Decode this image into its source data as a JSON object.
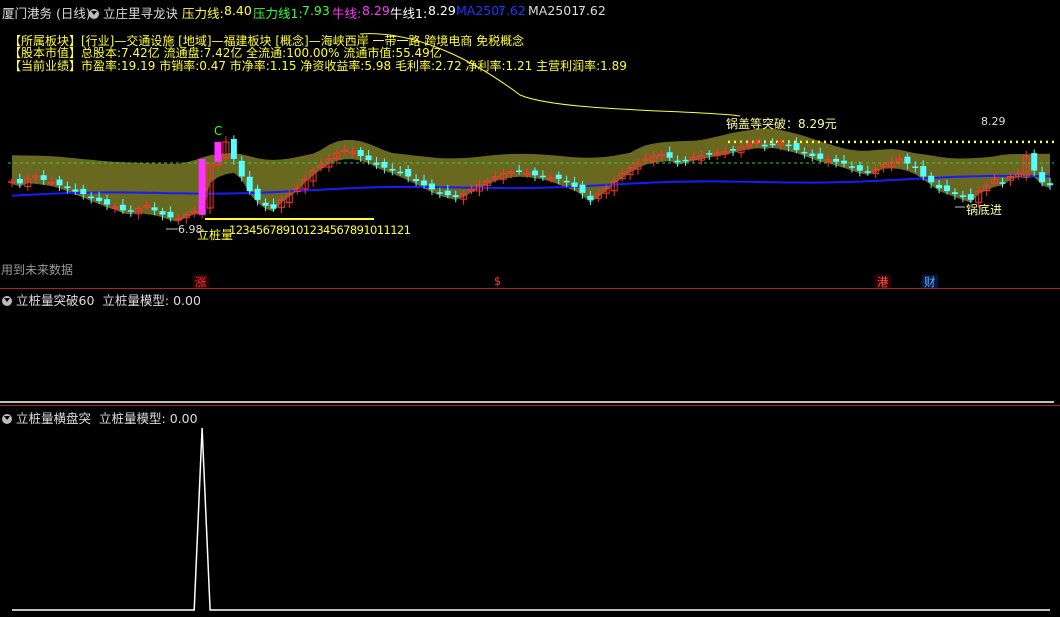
{
  "header": {
    "title": "厦门港务 (日线)",
    "indicator": "立庄里寻龙诀",
    "pressure_label": "压力线:",
    "pressure_value": "8.40",
    "pressure1_label": "压力线1:",
    "pressure1_value": "7.93",
    "bull_label": "牛线:",
    "bull_value": "8.29",
    "bull1_label": "牛线1:",
    "bull1_value": "8.29",
    "ma250_label": "MA250:",
    "ma250_value": "7.62",
    "ma2501_label": "MA2501:",
    "ma2501_value": "7.62"
  },
  "info": {
    "line1": "【所属板块】[行业]—交通设施 [地域]—福建板块 [概念]—海峡西岸 一带一路 跨境电商 免税概念",
    "line2": "【股本市值】总股本:7.42亿 流通盘:7.42亿 全流通:100.00% 流通市值:55.49亿",
    "line3": "【当前业绩】市盈率:19.19 市销率:0.47 市净率:1.15 净资收益率:5.98 毛利率:2.72 净利率:1.21 主营利润率:1.89"
  },
  "annotations": {
    "c_label": "C",
    "pot_break": "锅盖等突破：8.29元",
    "price_829": "8.29",
    "pot_bottom": "锅底进",
    "low_price": "6.98",
    "lizhuang": "立桩量",
    "counter": "123456789101234567891011121",
    "future_data": "用到未来数据"
  },
  "event_tags": [
    {
      "text": "涨",
      "color": "#ff3333",
      "bg": "#330000"
    },
    {
      "text": "$",
      "color": "#ff3333",
      "bg": ""
    },
    {
      "text": "港",
      "color": "#ff5555",
      "bg": "#330000"
    },
    {
      "text": "财",
      "color": "#66aaff",
      "bg": "#001a44"
    }
  ],
  "panel2": {
    "name": "立桩量突破60",
    "model_label": "立桩量模型:",
    "model_value": "0.00"
  },
  "panel3": {
    "name": "立桩量横盘突",
    "model_label": "立桩量模型:",
    "model_value": "0.00"
  },
  "colors": {
    "up": "#ff3333",
    "down": "#54ffff",
    "cloud": "#7a7a26",
    "ma": "#1a1aff",
    "yellow": "#ffff33",
    "pink": "#ff33ff"
  },
  "chart_data": [
    {
      "type": "candlestick",
      "title": "厦门港务 (日线)",
      "pressure_line": 8.4,
      "pressure_line_1": 7.93,
      "bull_line": 8.29,
      "ma250": 7.62,
      "breakout_price": 8.29,
      "low_annotation": 6.98,
      "close": [
        7.62,
        7.58,
        7.66,
        7.71,
        7.64,
        7.6,
        7.55,
        7.5,
        7.44,
        7.4,
        7.33,
        7.28,
        7.22,
        7.18,
        7.12,
        7.1,
        7.15,
        7.2,
        7.12,
        7.05,
        7.0,
        6.98,
        7.05,
        7.1,
        7.12,
        7.9,
        8.05,
        8.29,
        8.0,
        7.7,
        7.45,
        7.3,
        7.2,
        7.15,
        7.3,
        7.4,
        7.5,
        7.65,
        7.8,
        7.9,
        8.0,
        8.1,
        8.15,
        8.12,
        8.05,
        7.98,
        7.9,
        7.85,
        7.8,
        7.78,
        7.7,
        7.62,
        7.55,
        7.48,
        7.42,
        7.38,
        7.35,
        7.4,
        7.48,
        7.56,
        7.62,
        7.7,
        7.75,
        7.78,
        7.8,
        7.76,
        7.72,
        7.7,
        7.68,
        7.66,
        7.6,
        7.52,
        7.42,
        7.3,
        7.4,
        7.5,
        7.62,
        7.75,
        7.85,
        7.93,
        8.0,
        8.05,
        8.08,
        8.02,
        7.95,
        7.98,
        8.02,
        8.05,
        8.08,
        8.1,
        8.12,
        8.15,
        8.2,
        8.25,
        8.29,
        8.22,
        8.25,
        8.28,
        8.22,
        8.15,
        8.1,
        8.05,
        8.0,
        7.98,
        7.95,
        7.92,
        7.85,
        7.8,
        7.78,
        7.82,
        7.9,
        7.95,
        8.0,
        7.92,
        7.85,
        7.7,
        7.6,
        7.5,
        7.45,
        7.4,
        7.35,
        7.3,
        7.45,
        7.55,
        7.65,
        7.6,
        7.7,
        7.75,
        8.05,
        7.8,
        7.6,
        7.55
      ]
    },
    {
      "type": "line",
      "title": "立桩量突破60",
      "series": [
        {
          "name": "立桩量模型",
          "values": [
            0
          ]
        }
      ]
    },
    {
      "type": "line",
      "title": "立桩量横盘突",
      "series": [
        {
          "name": "立桩量模型",
          "values": [
            0,
            0,
            0,
            0,
            0,
            0,
            0,
            0,
            0,
            0,
            0,
            0,
            0,
            0,
            0,
            0,
            0,
            0,
            0,
            0,
            0,
            0,
            0,
            0,
            1,
            0,
            0,
            0,
            0,
            0,
            0,
            0,
            0,
            0,
            0,
            0,
            0,
            0,
            0,
            0,
            0,
            0,
            0,
            0,
            0,
            0,
            0,
            0,
            0,
            0,
            0,
            0,
            0,
            0,
            0,
            0,
            0,
            0,
            0,
            0,
            0,
            0,
            0,
            0,
            0,
            0,
            0,
            0,
            0,
            0,
            0,
            0,
            0,
            0,
            0,
            0,
            0,
            0,
            0,
            0,
            0,
            0,
            0,
            0,
            0,
            0,
            0,
            0,
            0,
            0,
            0,
            0,
            0,
            0,
            0,
            0,
            0,
            0,
            0,
            0,
            0,
            0,
            0,
            0,
            0,
            0,
            0,
            0,
            0,
            0,
            0,
            0,
            0,
            0,
            0,
            0,
            0,
            0,
            0,
            0,
            0,
            0,
            0,
            0,
            0,
            0,
            0,
            0,
            0,
            0,
            0,
            0
          ]
        }
      ]
    }
  ]
}
